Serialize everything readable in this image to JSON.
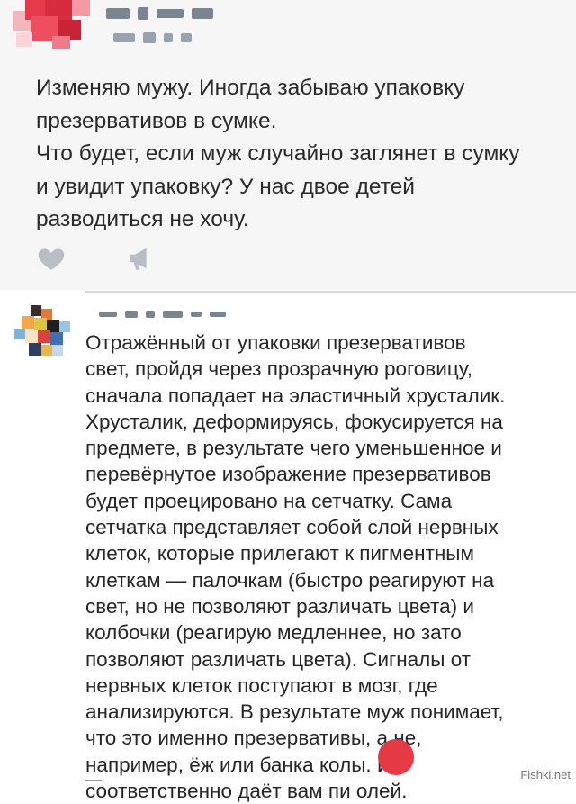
{
  "post": {
    "text_lines": [
      "Изменяю мужу. Иногда забываю упаковку",
      "презервативов в сумке.",
      "Что будет, если муж случайно заглянет в сумку",
      "и увидит упаковку? У нас двое детей",
      "разводиться не хочу."
    ],
    "actions": [
      "heart-icon",
      "megaphone-icon"
    ]
  },
  "comment": {
    "text_lines": [
      "Отражённый от упаковки презервативов",
      "свет, пройдя через прозрачную роговицу,",
      "сначала попадает на эластичный хрусталик.",
      "Хрусталик, деформируясь, фокусируется на",
      "предмете, в результате чего уменьшенное и",
      "перевёрнутое изображение презервативов",
      "будет проецировано на сетчатку. Сама",
      "сетчатка представляет собой слой нервных",
      "клеток, которые прилегают к пигментным",
      "клеткам — палочкам (быстро реагируют на",
      "свет, но не позволяют различать цвета) и",
      "колбочки (реагирую медленнее, но зато",
      "позволяют различать цвета). Сигналы от",
      "нервных клеток поступают в мозг, где",
      "анализируются. В результате муж понимает,",
      "что это именно презервативы, а не,",
      "например, ёж или банка колы. И",
      "соответственно даёт вам пи  олей."
    ]
  },
  "watermark": "Fishki.net",
  "colors": {
    "post_bg": "#f6f6f7",
    "comment_bg": "#ffffff",
    "text": "#2a2a2a",
    "icon_gray": "#b9bec6",
    "censor_red": "#e63946"
  }
}
